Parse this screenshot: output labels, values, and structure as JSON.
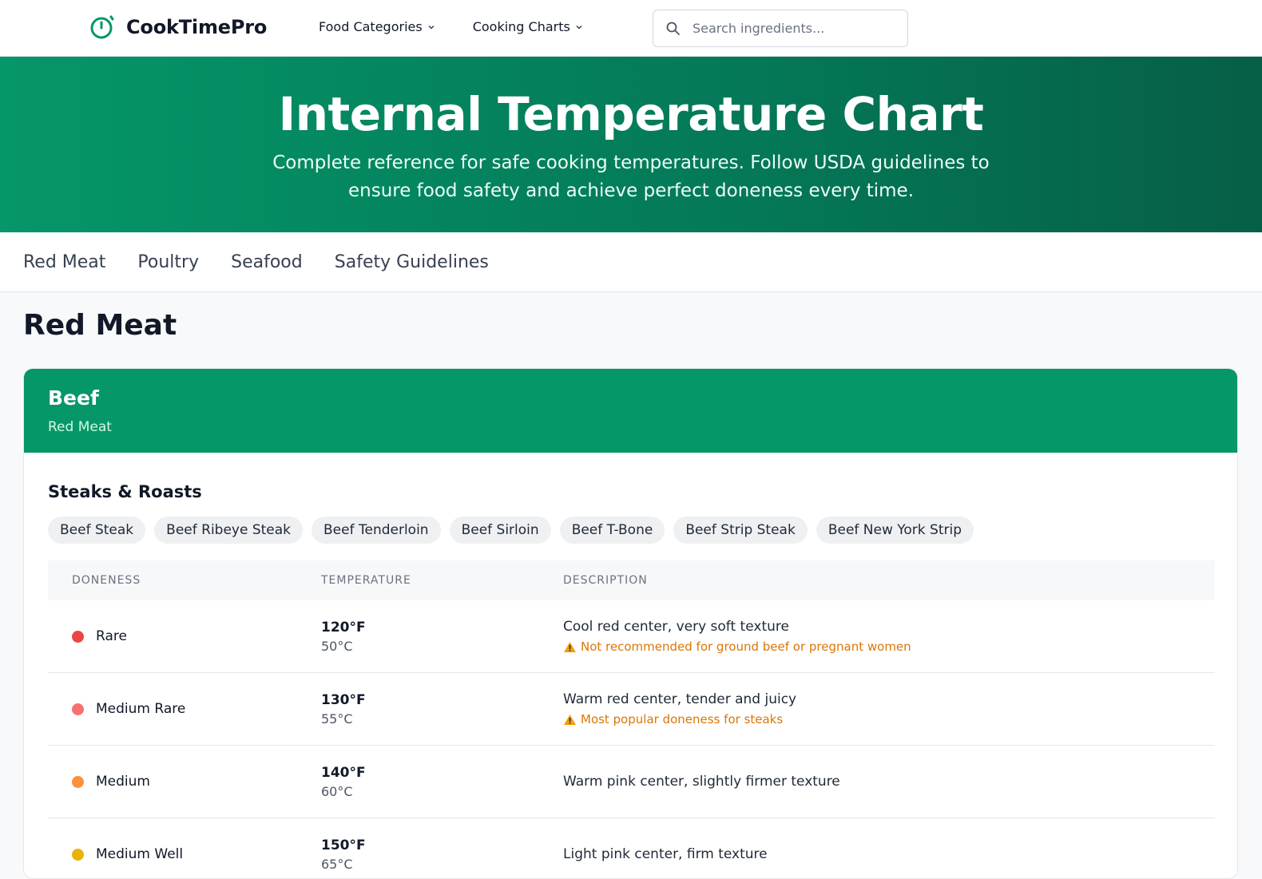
{
  "header": {
    "brand": "CookTimePro",
    "nav": [
      {
        "label": "Food Categories"
      },
      {
        "label": "Cooking Charts"
      }
    ],
    "search_placeholder": "Search ingredients..."
  },
  "hero": {
    "title": "Internal Temperature Chart",
    "subtitle": "Complete reference for safe cooking temperatures. Follow USDA guidelines to ensure food safety and achieve perfect doneness every time."
  },
  "tabs": [
    "Red Meat",
    "Poultry",
    "Seafood",
    "Safety Guidelines"
  ],
  "section": {
    "title": "Red Meat",
    "card": {
      "title": "Beef",
      "subtitle": "Red Meat",
      "group_title": "Steaks & Roasts",
      "chips": [
        "Beef Steak",
        "Beef Ribeye Steak",
        "Beef Tenderloin",
        "Beef Sirloin",
        "Beef T-Bone",
        "Beef Strip Steak",
        "Beef New York Strip"
      ],
      "table": {
        "headers": [
          "DONENESS",
          "TEMPERATURE",
          "DESCRIPTION"
        ],
        "rows": [
          {
            "doneness": "Rare",
            "color": "#ef4444",
            "temp_f": "120°F",
            "temp_c": "50°C",
            "description": "Cool red center, very soft texture",
            "note": "Not recommended for ground beef or pregnant women"
          },
          {
            "doneness": "Medium Rare",
            "color": "#f87171",
            "temp_f": "130°F",
            "temp_c": "55°C",
            "description": "Warm red center, tender and juicy",
            "note": "Most popular doneness for steaks"
          },
          {
            "doneness": "Medium",
            "color": "#fb923c",
            "temp_f": "140°F",
            "temp_c": "60°C",
            "description": "Warm pink center, slightly firmer texture",
            "note": ""
          },
          {
            "doneness": "Medium Well",
            "color": "#eab308",
            "temp_f": "150°F",
            "temp_c": "65°C",
            "description": "Light pink center, firm texture",
            "note": ""
          }
        ]
      }
    }
  },
  "colors": {
    "accent": "#059669",
    "warning": "#d97706"
  }
}
